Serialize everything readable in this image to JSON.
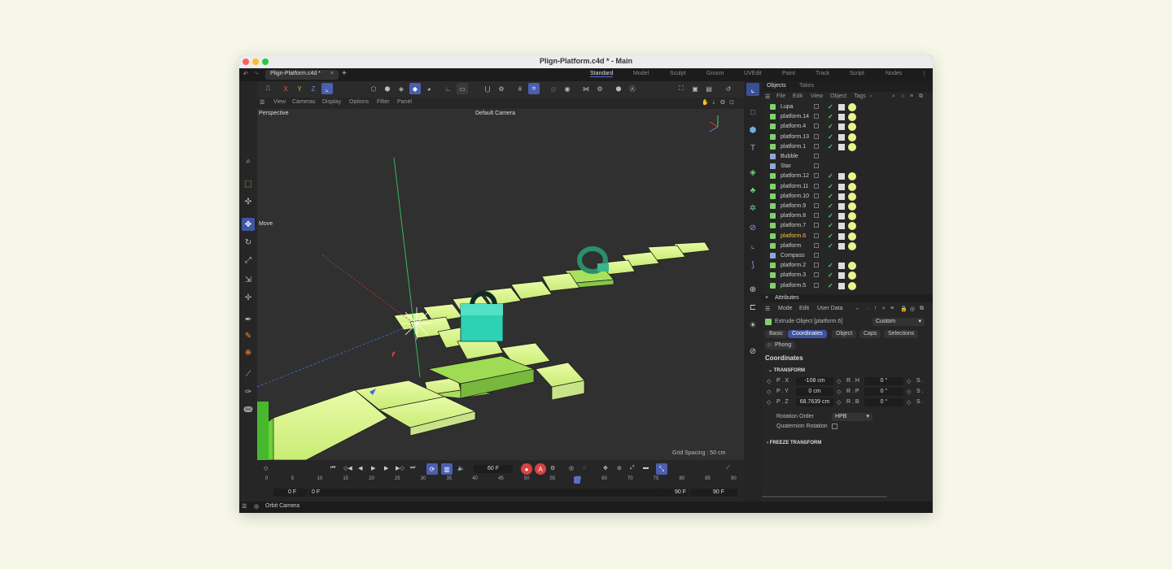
{
  "window": {
    "title": "Plign-Platform.c4d * - Main",
    "doc_tab": "Plign-Platform.c4d *",
    "workspaces": [
      "Standard",
      "Model",
      "Sculpt",
      "Groom",
      "UVEdit",
      "Paint",
      "Track",
      "Script",
      "Nodes"
    ]
  },
  "toolbar": {
    "axes": [
      "X",
      "Y",
      "Z"
    ]
  },
  "viewport": {
    "menu": [
      "View",
      "Cameras",
      "Display",
      "Options",
      "Filter",
      "Panel"
    ],
    "projection": "Perspective",
    "camera": "Default Camera",
    "tool_label": "Move",
    "grid_spacing": "Grid Spacing : 50 cm"
  },
  "timeline": {
    "current_frame": "60 F",
    "ticks": [
      "0",
      "5",
      "10",
      "15",
      "20",
      "25",
      "30",
      "35",
      "40",
      "45",
      "50",
      "55",
      "60",
      "65",
      "70",
      "75",
      "80",
      "85",
      "90"
    ],
    "start_a": "0 F",
    "start_b": "0 F",
    "end_a": "90 F",
    "end_b": "90 F"
  },
  "objects_panel": {
    "tabs": [
      "Objects",
      "Takes"
    ],
    "menu": [
      "File",
      "Edit",
      "View",
      "Object",
      "Tags"
    ],
    "rows": [
      {
        "name": "Lupa",
        "color": "#7fd36b",
        "tags": true
      },
      {
        "name": "platform.14",
        "color": "#7fd36b",
        "tags": true
      },
      {
        "name": "platform.4",
        "color": "#7fd36b",
        "tags": true
      },
      {
        "name": "platform.13",
        "color": "#7fd36b",
        "tags": true
      },
      {
        "name": "platform.1",
        "color": "#7fd36b",
        "tags": true
      },
      {
        "name": "Bubble",
        "color": "#8fa7d8",
        "tags": false
      },
      {
        "name": "Star",
        "color": "#8fa7d8",
        "tags": false
      },
      {
        "name": "platform.12",
        "color": "#7fd36b",
        "tags": true
      },
      {
        "name": "platform.11",
        "color": "#7fd36b",
        "tags": true
      },
      {
        "name": "platform.10",
        "color": "#7fd36b",
        "tags": true
      },
      {
        "name": "platform.9",
        "color": "#7fd36b",
        "tags": true
      },
      {
        "name": "platform.8",
        "color": "#7fd36b",
        "tags": true
      },
      {
        "name": "platform.7",
        "color": "#7fd36b",
        "tags": true
      },
      {
        "name": "platform.6",
        "color": "#7fd36b",
        "tags": true,
        "selected": true
      },
      {
        "name": "platform",
        "color": "#7fd36b",
        "tags": true
      },
      {
        "name": "Compass",
        "color": "#8fa7d8",
        "tags": false
      },
      {
        "name": "platform.2",
        "color": "#7fd36b",
        "tags": true
      },
      {
        "name": "platform.3",
        "color": "#7fd36b",
        "tags": true
      },
      {
        "name": "platform.5",
        "color": "#7fd36b",
        "tags": true
      }
    ]
  },
  "attributes": {
    "header": "Attributes",
    "menu": [
      "Mode",
      "Edit",
      "User Data"
    ],
    "object_label": "Extrude Object [platform.6]",
    "preset": "Custom",
    "tabs": [
      "Basic",
      "Coordinates",
      "Object",
      "Caps",
      "Selections"
    ],
    "phong_tab": "Phong",
    "section": "Coordinates",
    "transform_label": "TRANSFORM",
    "px_label": "P . X",
    "py_label": "P . Y",
    "pz_label": "P . Z",
    "rh_label": "R . H",
    "rp_label": "R . P",
    "rb_label": "R . B",
    "s_label": "S .",
    "px": "-108 cm",
    "py": "0 cm",
    "pz": "68.7639 cm",
    "rh": "0 °",
    "rp": "0 °",
    "rb": "0 °",
    "rotation_order_label": "Rotation Order",
    "rotation_order": "HPB",
    "quaternion_label": "Quaternion Rotation",
    "freeze_label": "FREEZE TRANSFORM"
  },
  "status": {
    "text": "Orbit Camera"
  },
  "colors": {
    "accent": "#4a5fb0",
    "platform_green": "#d7f58a",
    "selected_yellow": "#f5c542"
  }
}
